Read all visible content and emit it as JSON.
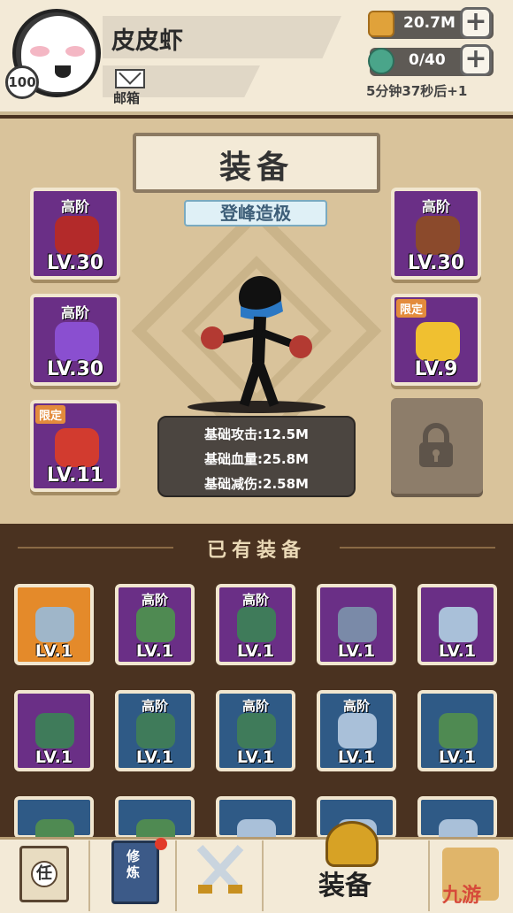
{
  "header": {
    "player_name": "皮皮虾",
    "level": "100",
    "mail_label": "邮箱",
    "gold_value": "20.7M",
    "energy_value": "0/40",
    "timer_text": "5分钟37秒后+1"
  },
  "equip": {
    "title": "装备",
    "rank": "登峰造极",
    "slots": [
      {
        "grade": "高阶",
        "level": "LV.30",
        "tag": "",
        "icon": "boxing-glove-icon",
        "color": "#b32a2a"
      },
      {
        "grade": "高阶",
        "level": "LV.30",
        "tag": "",
        "icon": "armor-vest-icon",
        "color": "#8a4fd0"
      },
      {
        "grade": "",
        "level": "LV.11",
        "tag": "限定",
        "icon": "chinese-knot-icon",
        "color": "#d23b2f"
      },
      {
        "grade": "高阶",
        "level": "LV.30",
        "tag": "",
        "icon": "straw-hat-icon",
        "color": "#8b4a2c"
      },
      {
        "grade": "",
        "level": "LV.9",
        "tag": "限定",
        "icon": "gold-ingot-icon",
        "color": "#f0c030"
      }
    ],
    "stats": [
      "基础攻击:12.5M",
      "基础血量:25.8M",
      "基础减伤:2.58M"
    ]
  },
  "owned": {
    "title": "已有装备",
    "items": [
      {
        "grade": "",
        "level": "LV.1",
        "bg": "#e48a2a",
        "icon": "sword-icon",
        "color": "#9fb6c9"
      },
      {
        "grade": "高阶",
        "level": "LV.1",
        "bg": "#6a2f86",
        "icon": "bracelet-icon",
        "color": "#4f8a52"
      },
      {
        "grade": "高阶",
        "level": "LV.1",
        "bg": "#6a2f86",
        "icon": "gauntlet-icon",
        "color": "#3f7b5a"
      },
      {
        "grade": "",
        "level": "LV.1",
        "bg": "#6a2f86",
        "icon": "amulet-icon",
        "color": "#7a8aa8"
      },
      {
        "grade": "",
        "level": "LV.1",
        "bg": "#6a2f86",
        "icon": "ring-icon",
        "color": "#a9c0d9"
      },
      {
        "grade": "",
        "level": "LV.1",
        "bg": "#6a2f86",
        "icon": "gauntlet-icon",
        "color": "#3f7b5a"
      },
      {
        "grade": "高阶",
        "level": "LV.1",
        "bg": "#2f5a86",
        "icon": "gauntlet-icon",
        "color": "#3f7b5a"
      },
      {
        "grade": "高阶",
        "level": "LV.1",
        "bg": "#2f5a86",
        "icon": "gauntlet-icon",
        "color": "#3f7b5a"
      },
      {
        "grade": "高阶",
        "level": "LV.1",
        "bg": "#2f5a86",
        "icon": "ring-icon",
        "color": "#a9c0d9"
      },
      {
        "grade": "",
        "level": "LV.1",
        "bg": "#2f5a86",
        "icon": "bracelet-icon",
        "color": "#4f8a52"
      },
      {
        "grade": "",
        "level": "",
        "bg": "#2f5a86",
        "icon": "bracelet-icon",
        "color": "#4f8a52"
      },
      {
        "grade": "",
        "level": "",
        "bg": "#2f5a86",
        "icon": "bracelet-icon",
        "color": "#4f8a52"
      },
      {
        "grade": "",
        "level": "",
        "bg": "#2f5a86",
        "icon": "ring-icon",
        "color": "#a9c0d9"
      },
      {
        "grade": "",
        "level": "",
        "bg": "#2f5a86",
        "icon": "ring-icon",
        "color": "#a9c0d9"
      },
      {
        "grade": "",
        "level": "",
        "bg": "#2f5a86",
        "icon": "ring-icon",
        "color": "#a9c0d9"
      }
    ]
  },
  "nav": {
    "quest_label": "任",
    "train_label": "修炼",
    "equip_label": "装备",
    "watermark": "九游"
  }
}
